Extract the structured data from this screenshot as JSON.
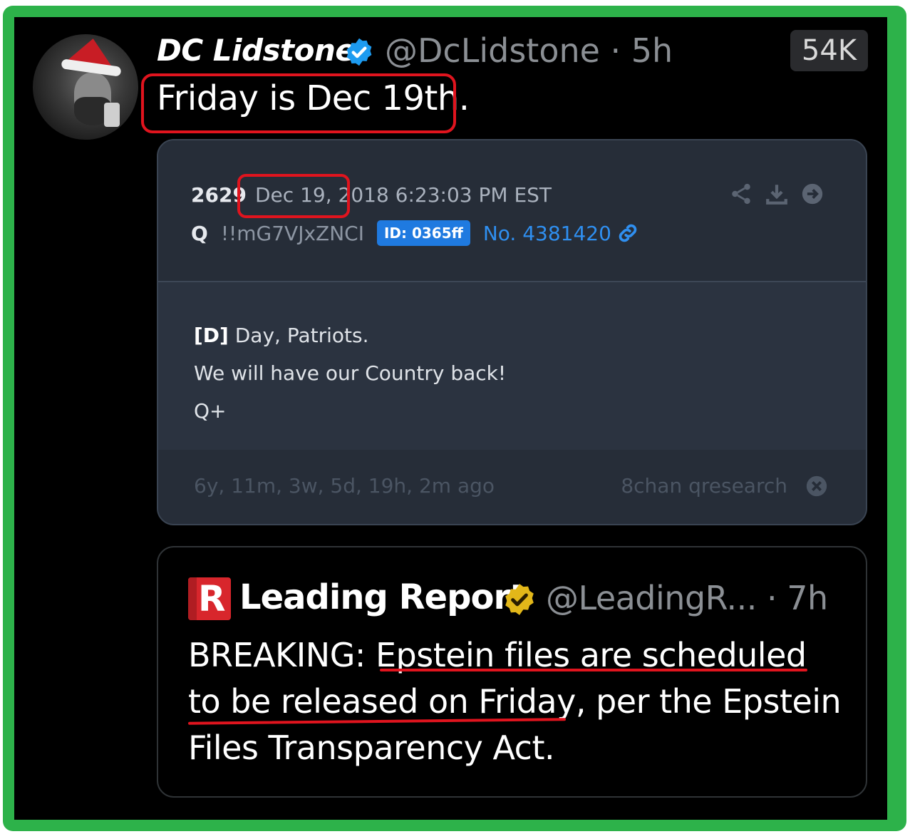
{
  "tweet": {
    "display_name": "DC Lidstone",
    "handle_time": "@DcLidstone · 5h",
    "views": "54K",
    "text": "Friday is Dec 19th."
  },
  "q_post": {
    "number": "2629",
    "datetime": "Dec 19, 2018 6:23:03 PM EST",
    "author": "Q",
    "tripcode": "!!mG7VJxZNCI",
    "id_badge": "ID: 0365ff",
    "post_no": "No. 4381420",
    "body": {
      "line1_bold": "[D]",
      "line1_rest": " Day, Patriots.",
      "line2": "We will have our Country back!",
      "line3": "Q+"
    },
    "ago": "6y, 11m, 3w, 5d, 19h, 2m ago",
    "source": "8chan qresearch",
    "icons": [
      "share-icon",
      "download-icon",
      "arrow-right-circle-icon",
      "link-icon",
      "close-circle-icon"
    ]
  },
  "quoted_tweet": {
    "display_name": "Leading Report",
    "handle_time": "@LeadingR... · 7h",
    "logo_text": "R",
    "text_line1": "BREAKING: Epstein files are scheduled",
    "text_line2": "to be released on Friday, per the Epstein",
    "text_line3": "Files Transparency Act."
  },
  "colors": {
    "frame": "#2db24a",
    "background": "#000000",
    "annotation_red": "#e0141e",
    "verified_blue": "#1d9bf0",
    "verified_gold": "#e2b719",
    "q_card": "#262d38",
    "link_blue": "#2f8ff0"
  }
}
